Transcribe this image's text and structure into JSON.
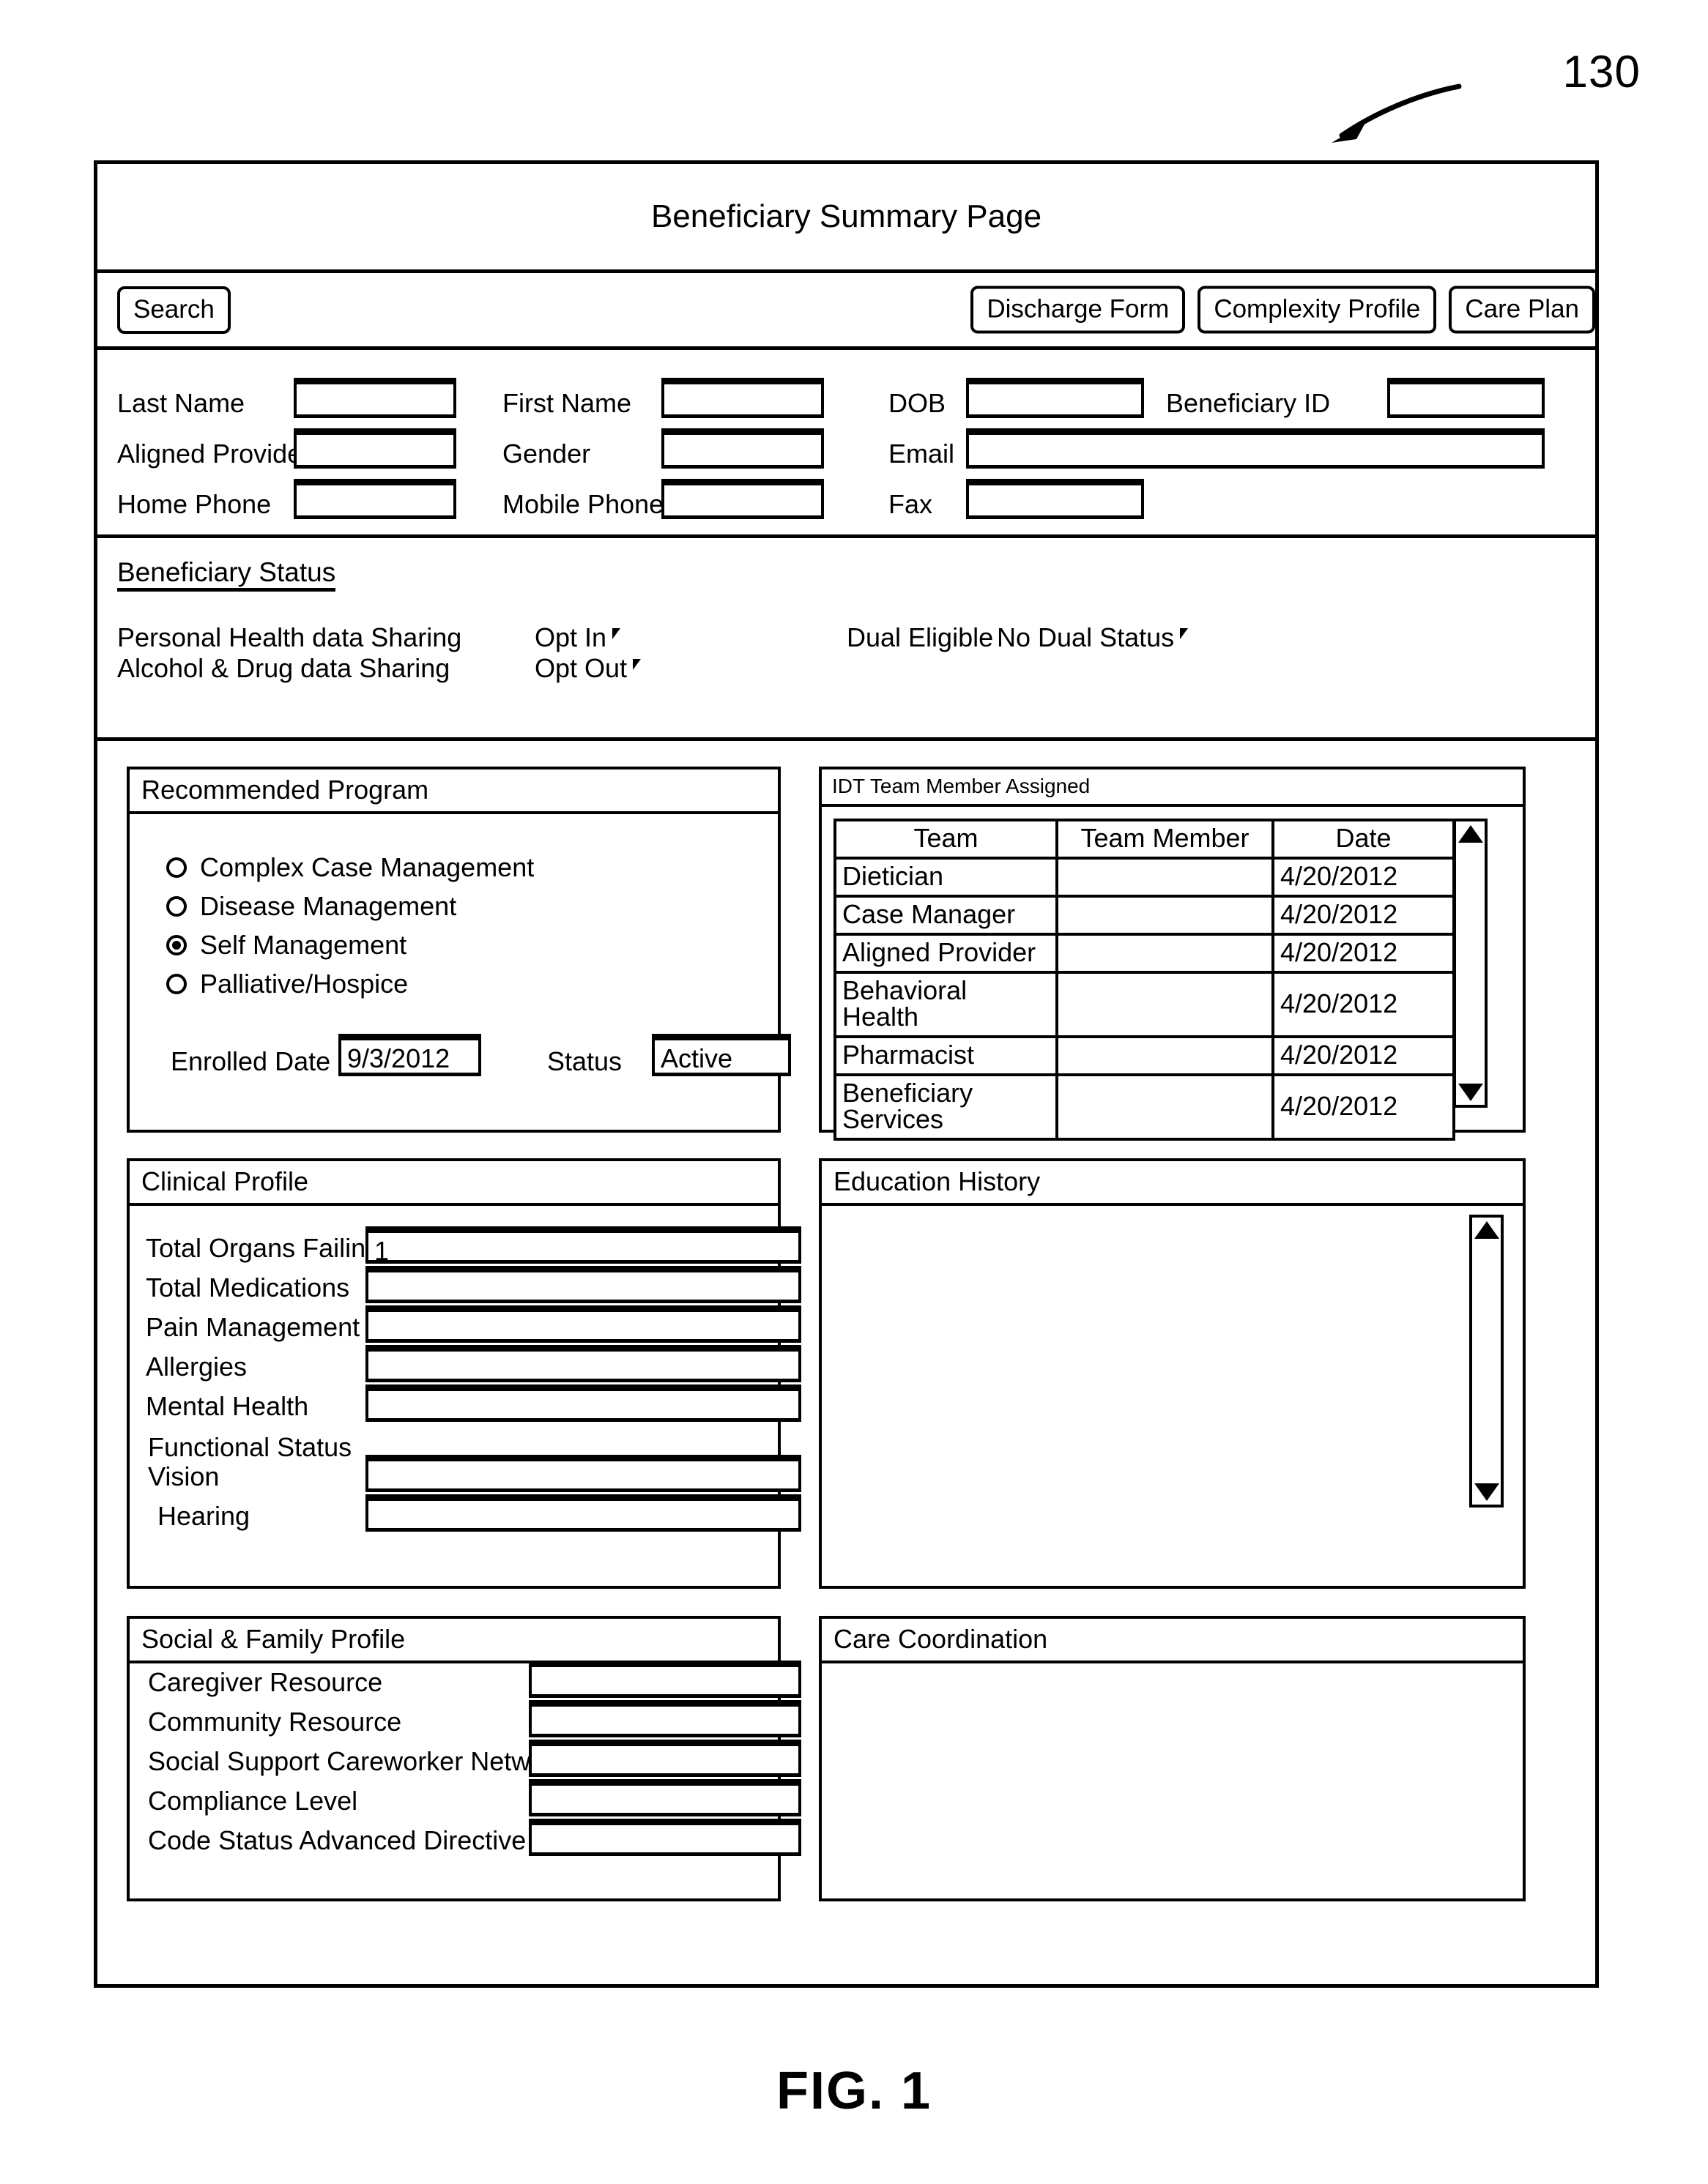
{
  "figure": {
    "reference_numeral": "130",
    "caption": "FIG. 1"
  },
  "header": {
    "title": "Beneficiary Summary Page"
  },
  "toolbar": {
    "search_label": "Search",
    "discharge_form_label": "Discharge Form",
    "complexity_profile_label": "Complexity Profile",
    "care_plan_label": "Care Plan"
  },
  "demographics": {
    "last_name": {
      "label": "Last Name",
      "value": ""
    },
    "first_name": {
      "label": "First Name",
      "value": ""
    },
    "dob": {
      "label": "DOB",
      "value": ""
    },
    "beneficiary_id": {
      "label": "Beneficiary ID",
      "value": ""
    },
    "aligned_provider": {
      "label": "Aligned Provider",
      "value": ""
    },
    "gender": {
      "label": "Gender",
      "value": ""
    },
    "email": {
      "label": "Email",
      "value": ""
    },
    "home_phone": {
      "label": "Home Phone",
      "value": ""
    },
    "mobile_phone": {
      "label": "Mobile Phone",
      "value": ""
    },
    "fax": {
      "label": "Fax",
      "value": ""
    }
  },
  "beneficiary_status": {
    "heading": "Beneficiary Status",
    "personal_health_label": "Personal Health data Sharing",
    "personal_health_value": "Opt In",
    "alcohol_drug_label": "Alcohol & Drug data Sharing",
    "alcohol_drug_value": "Opt Out",
    "dual_eligible_label": "Dual Eligible",
    "dual_eligible_value": "No Dual Status"
  },
  "recommended_program": {
    "title": "Recommended Program",
    "options": [
      {
        "label": "Complex Case Management",
        "selected": false
      },
      {
        "label": "Disease Management",
        "selected": false
      },
      {
        "label": "Self Management",
        "selected": true
      },
      {
        "label": "Palliative/Hospice",
        "selected": false
      }
    ],
    "enrolled_date_label": "Enrolled Date",
    "enrolled_date_value": "9/3/2012",
    "status_label": "Status",
    "status_value": "Active"
  },
  "idt_team": {
    "title": "IDT Team Member Assigned",
    "columns": [
      "Team",
      "Team Member",
      "Date"
    ],
    "rows": [
      {
        "team": "Dietician",
        "member": "",
        "date": "4/20/2012"
      },
      {
        "team": "Case Manager",
        "member": "",
        "date": "4/20/2012"
      },
      {
        "team": "Aligned Provider",
        "member": "",
        "date": "4/20/2012"
      },
      {
        "team": "Behavioral Health",
        "member": "",
        "date": "4/20/2012"
      },
      {
        "team": "Pharmacist",
        "member": "",
        "date": "4/20/2012"
      },
      {
        "team": "Beneficiary Services",
        "member": "",
        "date": "4/20/2012"
      }
    ]
  },
  "clinical_profile": {
    "title": "Clinical Profile",
    "fields": [
      {
        "label": "Total Organs Failing",
        "value": "1"
      },
      {
        "label": "Total Medications",
        "value": ""
      },
      {
        "label": "Pain Management",
        "value": ""
      },
      {
        "label": "Allergies",
        "value": ""
      },
      {
        "label": "Mental Health",
        "value": ""
      }
    ],
    "functional_status_label": "Functional Status",
    "functional_fields": [
      {
        "label": "Vision",
        "value": ""
      },
      {
        "label": "Hearing",
        "value": ""
      }
    ]
  },
  "education_history": {
    "title": "Education History",
    "content": ""
  },
  "social_family_profile": {
    "title": "Social & Family Profile",
    "fields": [
      {
        "label": "Caregiver Resource",
        "value": ""
      },
      {
        "label": "Community Resource",
        "value": ""
      },
      {
        "label": "Social Support Careworker Network",
        "value": ""
      },
      {
        "label": "Compliance Level",
        "value": ""
      },
      {
        "label": "Code Status Advanced Directive",
        "value": ""
      }
    ]
  },
  "care_coordination": {
    "title": "Care Coordination",
    "content": ""
  }
}
